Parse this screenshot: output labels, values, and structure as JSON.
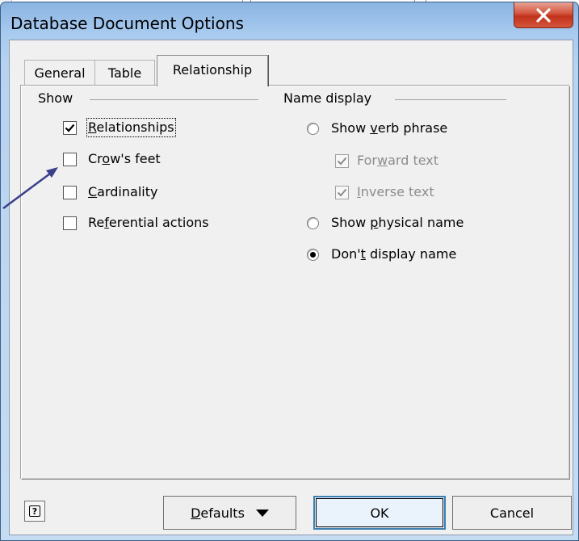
{
  "window": {
    "title": "Database Document Options",
    "close_icon": "close-x-icon"
  },
  "tabs": [
    {
      "label": "General",
      "selected": false
    },
    {
      "label": "Table",
      "selected": false
    },
    {
      "label": "Relationship",
      "selected": true
    }
  ],
  "show_group": {
    "label": "Show",
    "items": [
      {
        "pre": "",
        "mnemonic": "R",
        "post": "elationships",
        "checked": true
      },
      {
        "pre": "Cr",
        "mnemonic": "o",
        "post": "w's feet",
        "checked": false
      },
      {
        "pre": "",
        "mnemonic": "C",
        "post": "ardinality",
        "checked": false
      },
      {
        "pre": "Re",
        "mnemonic": "f",
        "post": "erential actions",
        "checked": false
      }
    ]
  },
  "name_display_group": {
    "label": "Name display",
    "show_verb_phrase": {
      "pre": "Show ",
      "mnemonic": "v",
      "post": "erb phrase",
      "selected": false
    },
    "forward_text": {
      "pre": "For",
      "mnemonic": "w",
      "post": "ard text",
      "checked": true,
      "disabled": true
    },
    "inverse_text": {
      "pre": "",
      "mnemonic": "I",
      "post": "nverse text",
      "checked": true,
      "disabled": true
    },
    "show_physical_name": {
      "pre": "Show ",
      "mnemonic": "p",
      "post": "hysical name",
      "selected": false
    },
    "dont_display_name": {
      "pre": "Don'",
      "mnemonic": "t",
      "post": " display name",
      "selected": true
    }
  },
  "buttons": {
    "help_icon": "help-icon",
    "defaults": {
      "pre": "",
      "mnemonic": "D",
      "post": "efaults"
    },
    "ok": "OK",
    "cancel": "Cancel"
  },
  "colors": {
    "title_bar": "#a9cbef",
    "close_button": "#c8452e",
    "annotation_arrow": "#3a3f8a"
  }
}
